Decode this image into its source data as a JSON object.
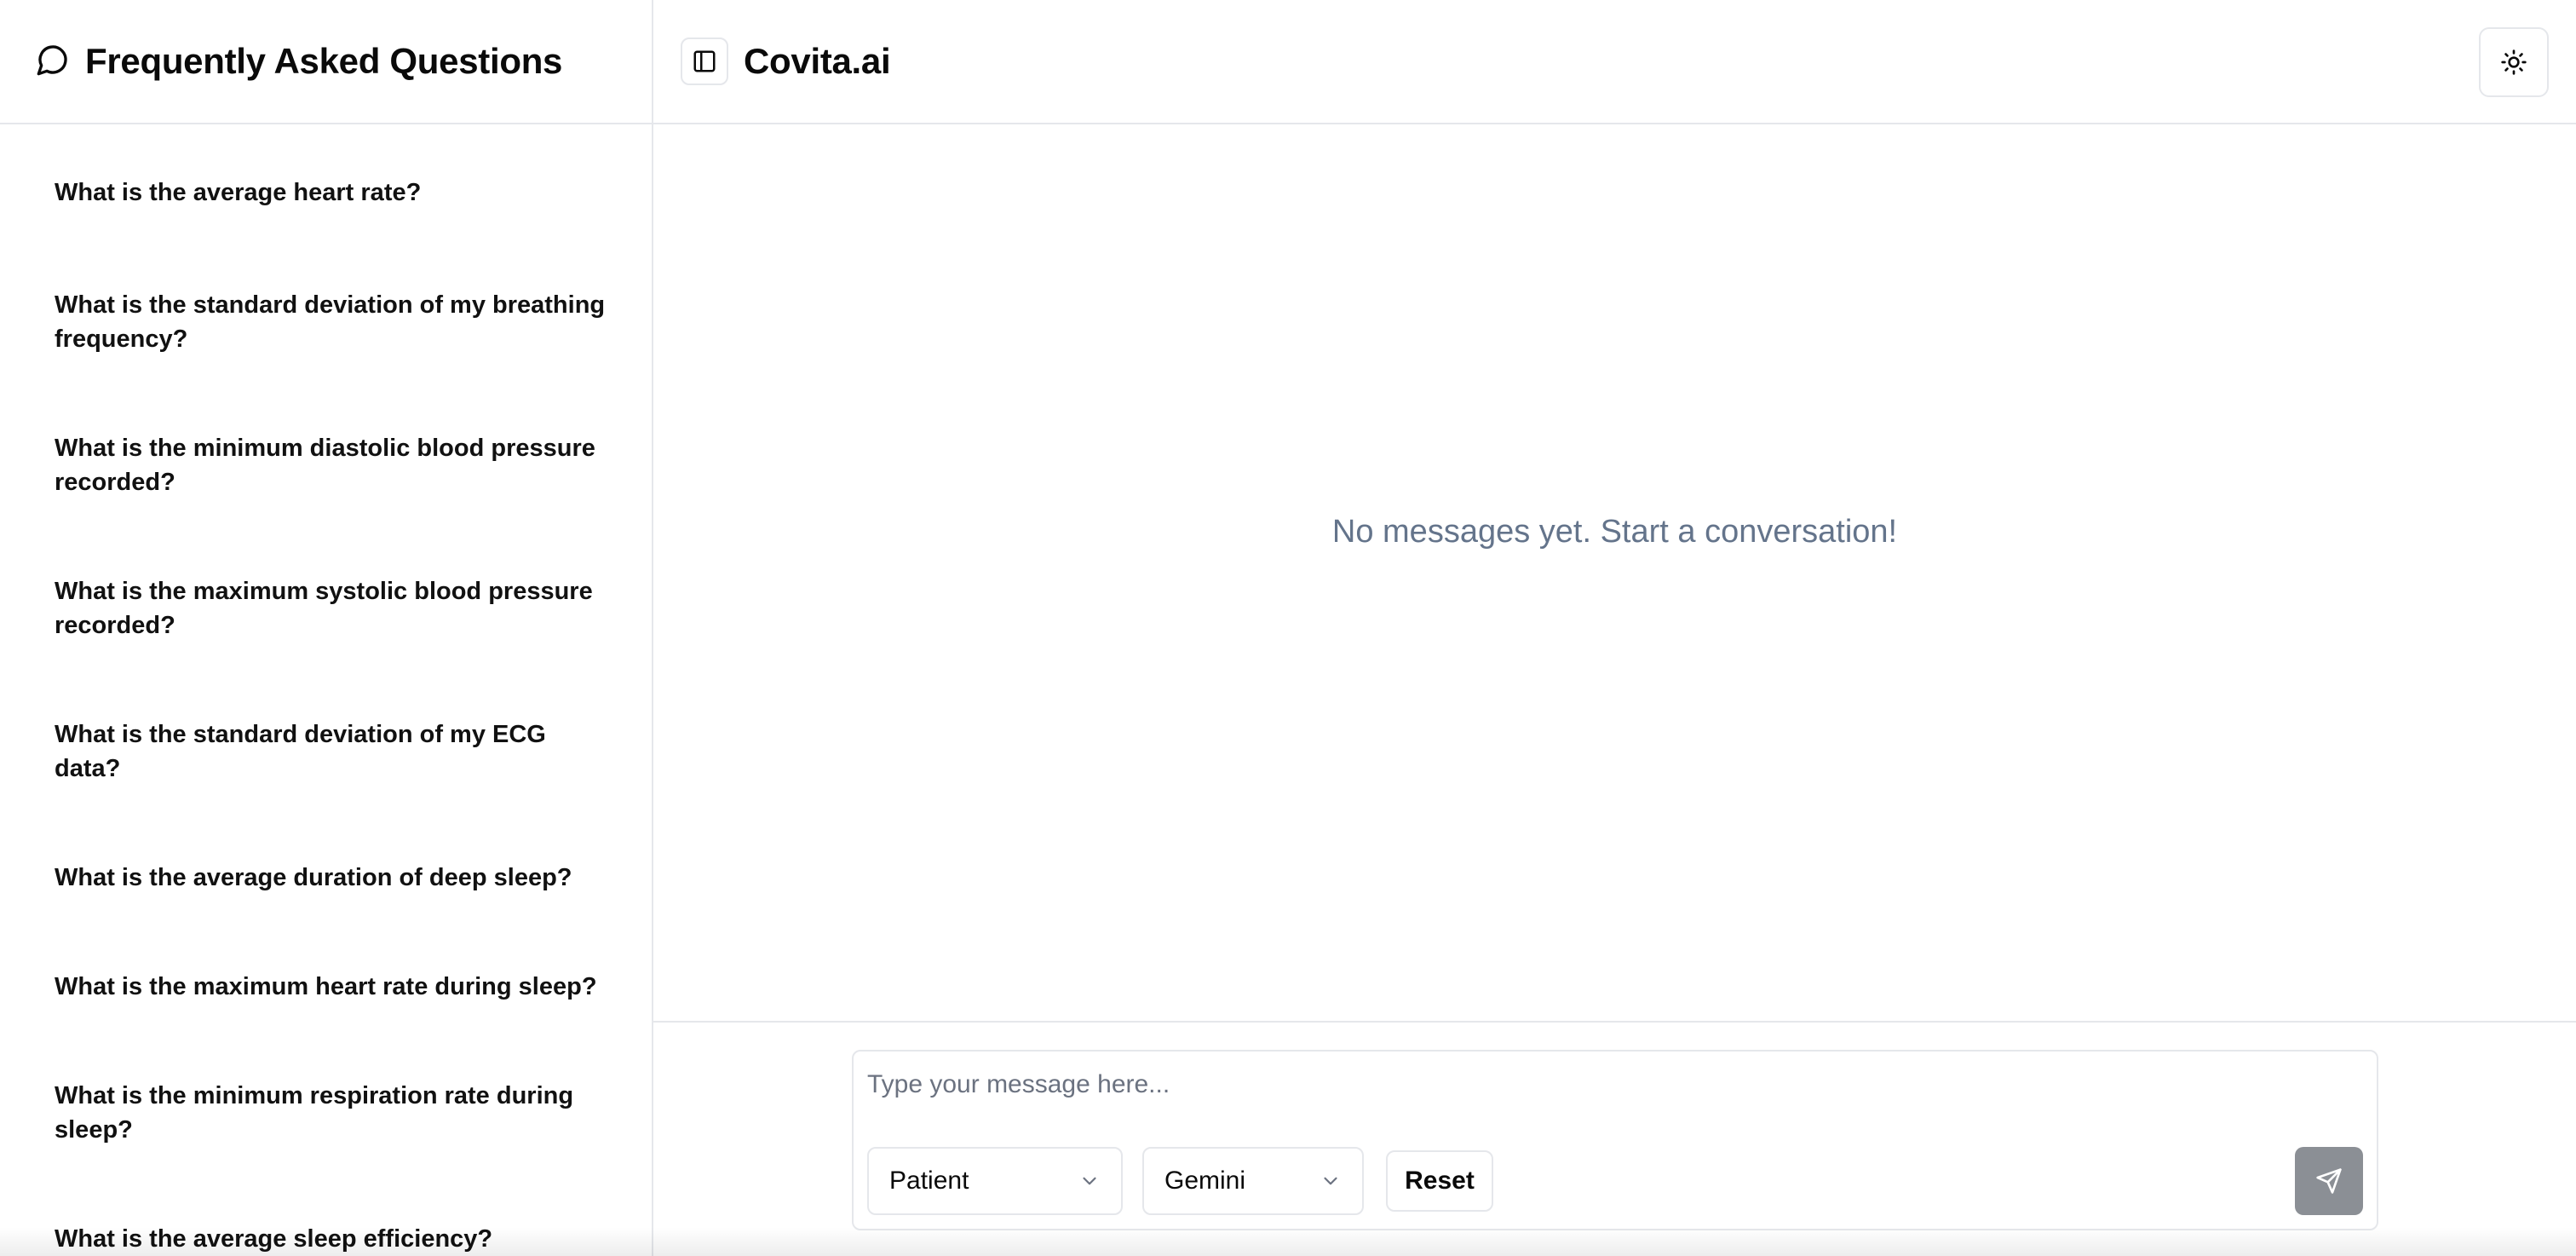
{
  "sidebar": {
    "title": "Frequently Asked Questions",
    "icon": "message-circle-icon",
    "faq": [
      "What is the average heart rate?",
      "What is the standard deviation of my breathing frequency?",
      "What is the minimum diastolic blood pressure recorded?",
      "What is the maximum systolic blood pressure recorded?",
      "What is the standard deviation of my ECG data?",
      "What is the average duration of deep sleep?",
      "What is the maximum heart rate during sleep?",
      "What is the minimum respiration rate during sleep?",
      "What is the average sleep efficiency?"
    ]
  },
  "header": {
    "app_title": "Covita.ai",
    "toggle_icon": "panel-left-icon",
    "theme_icon": "sun-icon"
  },
  "chat": {
    "empty_text": "No messages yet. Start a conversation!"
  },
  "composer": {
    "placeholder": "Type your message here...",
    "role_selected": "Patient",
    "model_selected": "Gemini",
    "reset_label": "Reset",
    "send_icon": "send-icon"
  }
}
